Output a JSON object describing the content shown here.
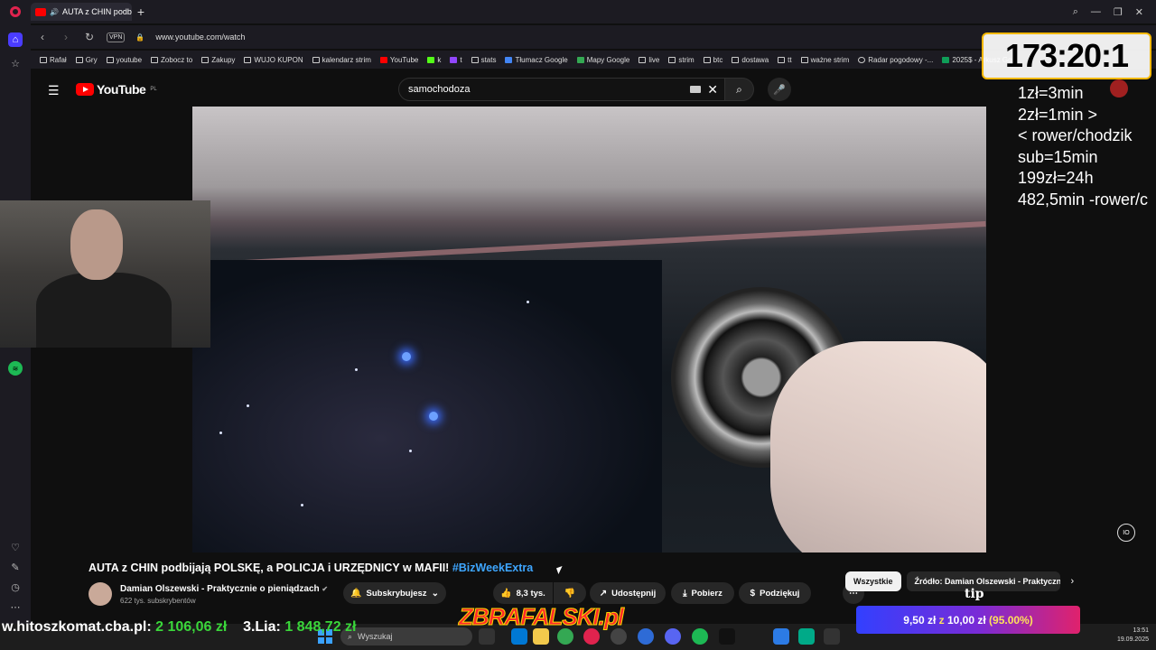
{
  "browser": {
    "tab_title": "AUTA z CHIN podbija",
    "url": "www.youtube.com/watch",
    "vpn_label": "VPN",
    "bookmarks": [
      "Rafał",
      "Gry",
      "youtube",
      "Zobocz to",
      "Zakupy",
      "WUJO KUPON",
      "kalendarz strim",
      "YouTube",
      "k",
      "t",
      "stats",
      "Tłumacz Google",
      "Mapy Google",
      "live",
      "strim",
      "btc",
      "dostawa",
      "tt",
      "ważne strim",
      "Radar pogodowy -...",
      "2025$ - Arkusz Go..."
    ]
  },
  "youtube": {
    "logo_text": "YouTube",
    "region": "PL",
    "search_value": "samochodoza",
    "video": {
      "title": "AUTA z CHIN podbijają POLSKĘ, a POLICJA i URZĘDNICY w MAFII!",
      "hashtag": "#BizWeekExtra"
    },
    "channel": {
      "name": "Damian Olszewski - Praktycznie o pieniądzach",
      "verified_mark": "✔",
      "subscribers": "622 tys. subskrybentów"
    },
    "actions": {
      "subscribe": "Subskrybujesz",
      "likes": "8,3 tys.",
      "share": "Udostępnij",
      "download": "Pobierz",
      "thanks": "Podziękuj"
    },
    "chips": [
      "Wszystkie",
      "Źródło: Damian Olszewski - Praktyczn"
    ]
  },
  "overlays": {
    "timer": "173:20:1",
    "rates": [
      "1zł=3min",
      "2zł=1min >",
      "< rower/chodzik",
      "sub=15min",
      "199zł=24h",
      "482,5min -rower/c"
    ],
    "goal_site": "w.hitoszkomat.cba.pl:",
    "goal_amount": "2 106,06 zł",
    "goal_place": "3.Lia:",
    "goal_amount2": "1 848,72 zł",
    "banner": "ZBRAFALSKI.pl",
    "tip_label": "tip",
    "donation_current": "9,50 zł",
    "donation_of": "z",
    "donation_target": "10,00 zł",
    "donation_percent": "(95.00%)"
  },
  "taskbar": {
    "search_placeholder": "Wyszukaj",
    "time": "13:51",
    "date": "19.09.2025"
  },
  "colors": {
    "youtube_red": "#ff0000",
    "link_blue": "#3ea6ff",
    "timer_border": "#f5b800",
    "goal_green": "#3ad63a"
  }
}
